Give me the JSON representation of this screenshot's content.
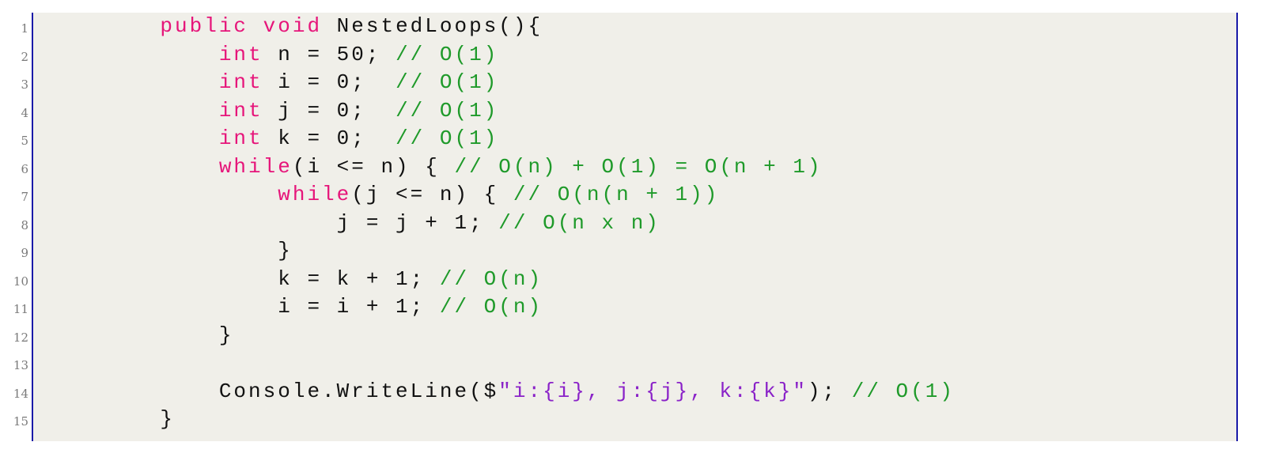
{
  "colors": {
    "background": "#f0efe9",
    "frame": "#1a1aa8",
    "keyword": "#e6157a",
    "comment": "#1f9a2a",
    "string": "#8a22c8",
    "plain": "#111111",
    "line_number": "#7a7a7a"
  },
  "lines": [
    {
      "no": "1",
      "indent": "    ",
      "tokens": [
        {
          "t": "kw",
          "v": "public void"
        },
        {
          "t": "pl",
          "v": " NestedLoops(){"
        }
      ]
    },
    {
      "no": "2",
      "indent": "        ",
      "tokens": [
        {
          "t": "kw",
          "v": "int"
        },
        {
          "t": "pl",
          "v": " n = 50; "
        },
        {
          "t": "cm",
          "v": "// O(1)"
        }
      ]
    },
    {
      "no": "3",
      "indent": "        ",
      "tokens": [
        {
          "t": "kw",
          "v": "int"
        },
        {
          "t": "pl",
          "v": " i = 0;  "
        },
        {
          "t": "cm",
          "v": "// O(1)"
        }
      ]
    },
    {
      "no": "4",
      "indent": "        ",
      "tokens": [
        {
          "t": "kw",
          "v": "int"
        },
        {
          "t": "pl",
          "v": " j = 0;  "
        },
        {
          "t": "cm",
          "v": "// O(1)"
        }
      ]
    },
    {
      "no": "5",
      "indent": "        ",
      "tokens": [
        {
          "t": "kw",
          "v": "int"
        },
        {
          "t": "pl",
          "v": " k = 0;  "
        },
        {
          "t": "cm",
          "v": "// O(1)"
        }
      ]
    },
    {
      "no": "6",
      "indent": "        ",
      "tokens": [
        {
          "t": "kw",
          "v": "while"
        },
        {
          "t": "pl",
          "v": "(i <= n) { "
        },
        {
          "t": "cm",
          "v": "// O(n) + O(1) = O(n + 1)"
        }
      ]
    },
    {
      "no": "7",
      "indent": "            ",
      "tokens": [
        {
          "t": "kw",
          "v": "while"
        },
        {
          "t": "pl",
          "v": "(j <= n) { "
        },
        {
          "t": "cm",
          "v": "// O(n(n + 1))"
        }
      ]
    },
    {
      "no": "8",
      "indent": "                ",
      "tokens": [
        {
          "t": "pl",
          "v": "j = j + 1; "
        },
        {
          "t": "cm",
          "v": "// O(n x n)"
        }
      ]
    },
    {
      "no": "9",
      "indent": "            ",
      "tokens": [
        {
          "t": "pl",
          "v": "}"
        }
      ]
    },
    {
      "no": "10",
      "indent": "            ",
      "tokens": [
        {
          "t": "pl",
          "v": "k = k + 1; "
        },
        {
          "t": "cm",
          "v": "// O(n)"
        }
      ]
    },
    {
      "no": "11",
      "indent": "            ",
      "tokens": [
        {
          "t": "pl",
          "v": "i = i + 1; "
        },
        {
          "t": "cm",
          "v": "// O(n)"
        }
      ]
    },
    {
      "no": "12",
      "indent": "        ",
      "tokens": [
        {
          "t": "pl",
          "v": "}"
        }
      ]
    },
    {
      "no": "13",
      "indent": "",
      "tokens": []
    },
    {
      "no": "14",
      "indent": "        ",
      "tokens": [
        {
          "t": "pl",
          "v": "Console.WriteLine($"
        },
        {
          "t": "st",
          "v": "\"i:{i}, j:{j}, k:{k}\""
        },
        {
          "t": "pl",
          "v": "); "
        },
        {
          "t": "cm",
          "v": "// O(1)"
        }
      ]
    },
    {
      "no": "15",
      "indent": "    ",
      "tokens": [
        {
          "t": "pl",
          "v": "}"
        }
      ]
    }
  ]
}
